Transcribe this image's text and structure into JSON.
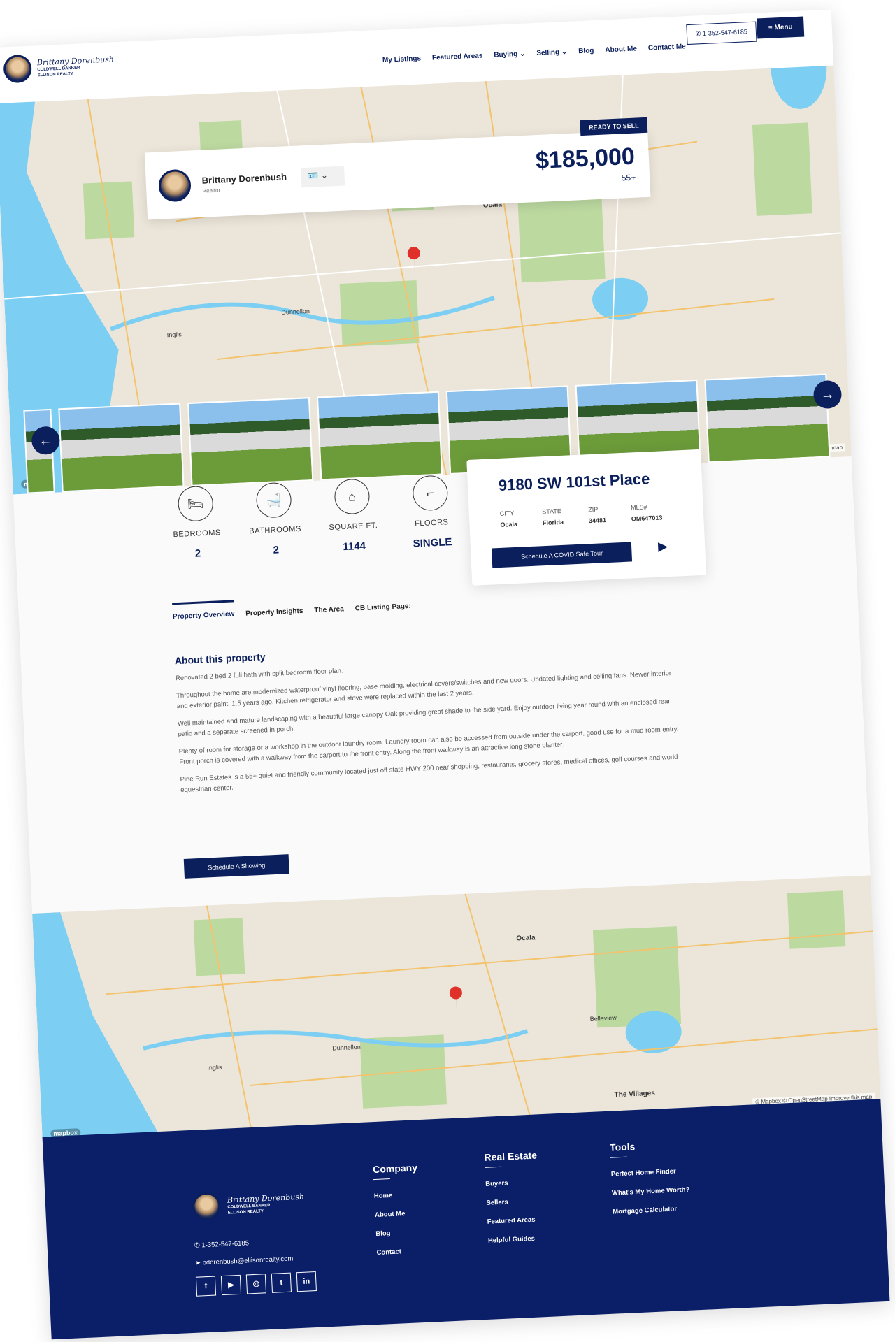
{
  "nav": {
    "signature": "Brittany Dorenbush",
    "brand": "COLDWELL BANKER",
    "brand_sub": "ELLISON REALTY",
    "links": [
      "My Listings",
      "Featured Areas",
      "Buying ⌄",
      "Selling ⌄",
      "Blog",
      "About Me",
      "Contact Me"
    ],
    "phone": "1-352-547-6185",
    "menu": "≡ Menu"
  },
  "agent": {
    "name": "Brittany Dorenbush",
    "role": "Realtor",
    "badge": "READY TO SELL",
    "price": "$185,000",
    "tag": "55+"
  },
  "map": {
    "attribution": "© Mapbox © OpenStreetMap Improve this map",
    "logo": "mapbox",
    "labels": [
      "Ocala",
      "Dunnellon",
      "Inglis",
      "Belleview",
      "The Villages"
    ]
  },
  "stats": [
    {
      "label": "BEDROOMS",
      "value": "2",
      "icon": "bed-icon"
    },
    {
      "label": "BATHROOMS",
      "value": "2",
      "icon": "bathtub-icon"
    },
    {
      "label": "SQUARE FT.",
      "value": "1144",
      "icon": "house-icon"
    },
    {
      "label": "FLOORS",
      "value": "SINGLE",
      "icon": "stairs-icon"
    }
  ],
  "address": {
    "title": "9180 SW 101st Place",
    "facts": [
      {
        "k": "CITY",
        "v": "Ocala"
      },
      {
        "k": "STATE",
        "v": "Florida"
      },
      {
        "k": "ZIP",
        "v": "34481"
      },
      {
        "k": "MLS#",
        "v": "OM647013"
      }
    ],
    "tour": "Schedule A COVID Safe Tour"
  },
  "tabs": [
    "Property Overview",
    "Property Insights",
    "The Area",
    "CB Listing Page:"
  ],
  "about": {
    "title": "About this property",
    "paragraphs": [
      "Renovated 2 bed 2 full bath with split bedroom floor plan.",
      "Throughout the home are modernized waterproof vinyl flooring, base molding, electrical covers/switches and new doors.  Updated lighting and ceiling fans.  Newer interior and exterior paint, 1.5 years ago.  Kitchen refrigerator and stove were replaced within the last 2 years.",
      "Well maintained and mature landscaping with a beautiful large canopy Oak providing great shade to the side yard. Enjoy outdoor living year round with an enclosed rear patio and a separate screened in porch.",
      "Plenty of room for storage or a workshop in the outdoor laundry room. Laundry room can also be accessed from outside under the carport, good use for a mud room entry. Front porch is covered with a walkway from the carport to the front entry. Along the front walkway is an attractive long stone planter.",
      "Pine Run Estates is a 55+ quiet and friendly community located just off state HWY 200 near shopping, restaurants, grocery stores, medical offices, golf courses and world equestrian center."
    ],
    "button": "Schedule A Showing"
  },
  "footer": {
    "company": {
      "title": "Company",
      "items": [
        "Home",
        "About Me",
        "Blog",
        "Contact"
      ]
    },
    "real_estate": {
      "title": "Real Estate",
      "items": [
        "Buyers",
        "Sellers",
        "Featured Areas",
        "Helpful Guides"
      ]
    },
    "tools": {
      "title": "Tools",
      "items": [
        "Perfect Home Finder",
        "What's My Home Worth?",
        "Mortgage Calculator"
      ]
    },
    "phone": "1-352-547-6185",
    "email": "bdorenbush@ellisonrealty.com",
    "social": [
      "f",
      "▶",
      "◎",
      "t",
      "in"
    ]
  },
  "colors": {
    "brand": "#0b1f5c",
    "footer": "#0b1f68",
    "pin": "#e0302a"
  }
}
